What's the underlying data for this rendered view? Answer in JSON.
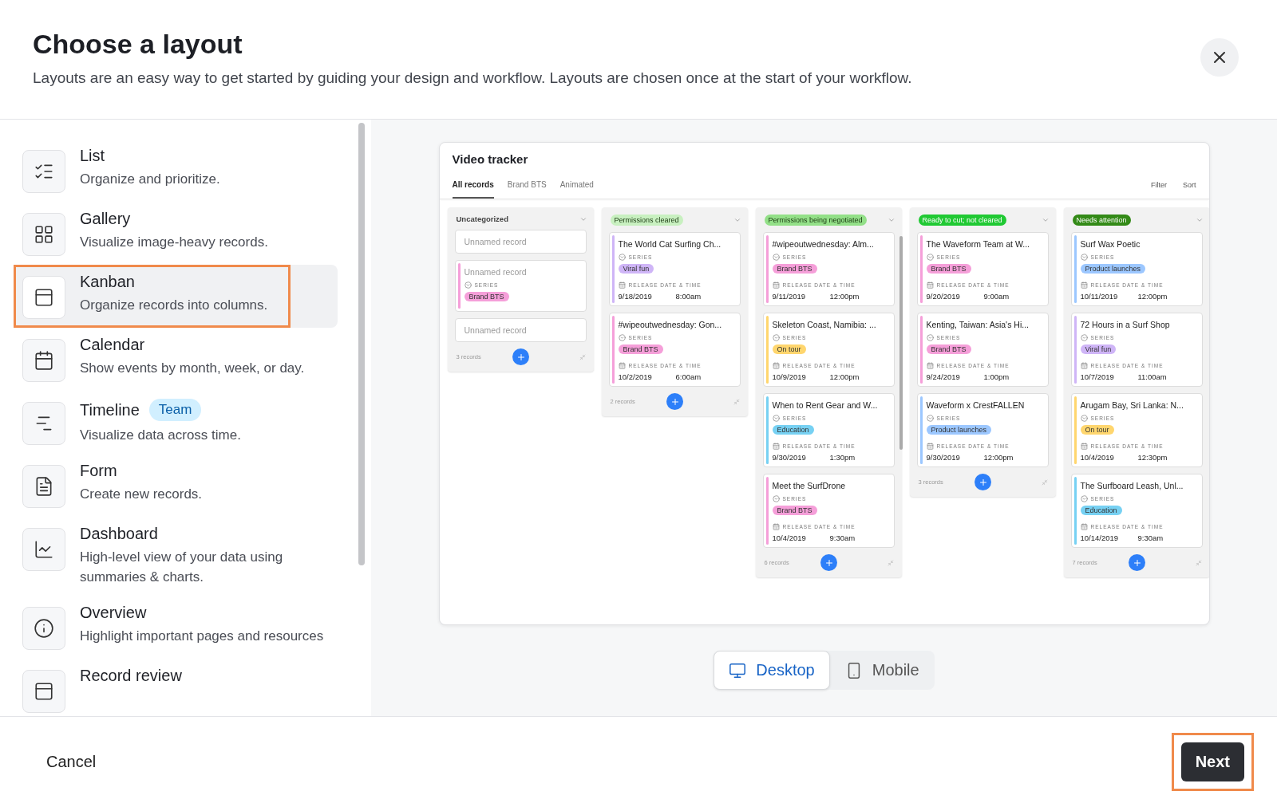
{
  "header": {
    "title": "Choose a layout",
    "description": "Layouts are an easy way to get started by guiding your design and workflow. Layouts are chosen once at the start of your workflow."
  },
  "layouts": [
    {
      "title": "List",
      "description": "Organize and prioritize.",
      "selected": false
    },
    {
      "title": "Gallery",
      "description": "Visualize image-heavy records.",
      "selected": false
    },
    {
      "title": "Kanban",
      "description": "Organize records into columns.",
      "selected": true
    },
    {
      "title": "Calendar",
      "description": "Show events by month, week, or day.",
      "selected": false
    },
    {
      "title": "Timeline",
      "badge": "Team",
      "description": "Visualize data across time.",
      "selected": false
    },
    {
      "title": "Form",
      "description": "Create new records.",
      "selected": false
    },
    {
      "title": "Dashboard",
      "description": "High-level view of your data using summaries & charts.",
      "selected": false
    },
    {
      "title": "Overview",
      "description": "Highlight important pages and resources",
      "selected": false
    },
    {
      "title": "Record review",
      "selected": false
    }
  ],
  "preview": {
    "title": "Video tracker",
    "tabs": [
      {
        "label": "All records",
        "selected": true
      },
      {
        "label": "Brand BTS",
        "selected": false
      },
      {
        "label": "Animated",
        "selected": false
      }
    ],
    "actions": [
      "Filter",
      "Sort"
    ],
    "columns": [
      {
        "name": "Uncategorized",
        "count": "3 records",
        "cards": [
          {
            "title": "Unnamed record",
            "placeholder": true
          },
          {
            "title": "Unnamed record",
            "placeholder": true,
            "series_label": "SERIES",
            "series": "Brand BTS",
            "color": "#f59fd9"
          },
          {
            "title": "Unnamed record",
            "placeholder": true
          }
        ]
      },
      {
        "name": "Permissions cleared",
        "color": "#c8f0c0",
        "count": "2 records",
        "cards": [
          {
            "title": "The World Cat Surfing Ch...",
            "placeholder": false,
            "series_label": "SERIES",
            "series": "Viral fun",
            "color": "#cfb5f7",
            "date_label": "RELEASE DATE & TIME",
            "date": "9/18/2019",
            "time": "8:00am"
          },
          {
            "title": "#wipeoutwednesday: Gon...",
            "placeholder": false,
            "series_label": "SERIES",
            "series": "Brand BTS",
            "color": "#f59fd9",
            "date_label": "RELEASE DATE & TIME",
            "date": "10/2/2019",
            "time": "6:00am"
          }
        ]
      },
      {
        "name": "Permissions being negotiated",
        "color": "#93e088",
        "count": "6 records",
        "cards": [
          {
            "title": "#wipeoutwednesday: Alm...",
            "placeholder": false,
            "series_label": "SERIES",
            "series": "Brand BTS",
            "color": "#f59fd9",
            "date_label": "RELEASE DATE & TIME",
            "date": "9/11/2019",
            "time": "12:00pm"
          },
          {
            "title": "Skeleton Coast, Namibia: ...",
            "placeholder": false,
            "series_label": "SERIES",
            "series": "On tour",
            "color": "#ffd66e",
            "date_label": "RELEASE DATE & TIME",
            "date": "10/9/2019",
            "time": "12:00pm"
          },
          {
            "title": "When to Rent Gear and W...",
            "placeholder": false,
            "series_label": "SERIES",
            "series": "Education",
            "color": "#77d1f3",
            "date_label": "RELEASE DATE & TIME",
            "date": "9/30/2019",
            "time": "1:30pm"
          },
          {
            "title": "Meet the SurfDrone",
            "placeholder": false,
            "series_label": "SERIES",
            "series": "Brand BTS",
            "color": "#f59fd9",
            "date_label": "RELEASE DATE & TIME",
            "date": "10/4/2019",
            "time": "9:30am"
          }
        ]
      },
      {
        "name": "Ready to cut; not cleared",
        "color": "#20c933",
        "count": "3 records",
        "cards": [
          {
            "title": "The Waveform Team at W...",
            "placeholder": false,
            "series_label": "SERIES",
            "series": "Brand BTS",
            "color": "#f59fd9",
            "date_label": "RELEASE DATE & TIME",
            "date": "9/20/2019",
            "time": "9:00am"
          },
          {
            "title": "Kenting, Taiwan: Asia's Hi...",
            "placeholder": false,
            "series_label": "SERIES",
            "series": "Brand BTS",
            "color": "#f59fd9",
            "date_label": "RELEASE DATE & TIME",
            "date": "9/24/2019",
            "time": "1:00pm"
          },
          {
            "title": "Waveform x CrestFALLEN",
            "placeholder": false,
            "series_label": "SERIES",
            "series": "Product launches",
            "color": "#9cc7ff",
            "date_label": "RELEASE DATE & TIME",
            "date": "9/30/2019",
            "time": "12:00pm"
          }
        ]
      },
      {
        "name": "Needs attention",
        "color": "#338a17",
        "count": "7 records",
        "cards": [
          {
            "title": "Surf Wax Poetic",
            "placeholder": false,
            "series_label": "SERIES",
            "series": "Product launches",
            "color": "#9cc7ff",
            "date_label": "RELEASE DATE & TIME",
            "date": "10/11/2019",
            "time": "12:00pm"
          },
          {
            "title": "72 Hours in a Surf Shop",
            "placeholder": false,
            "series_label": "SERIES",
            "series": "Viral fun",
            "color": "#cfb5f7",
            "date_label": "RELEASE DATE & TIME",
            "date": "10/7/2019",
            "time": "11:00am"
          },
          {
            "title": "Arugam Bay, Sri Lanka: N...",
            "placeholder": false,
            "series_label": "SERIES",
            "series": "On tour",
            "color": "#ffd66e",
            "date_label": "RELEASE DATE & TIME",
            "date": "10/4/2019",
            "time": "12:30pm"
          },
          {
            "title": "The Surfboard Leash, Unl...",
            "placeholder": false,
            "series_label": "SERIES",
            "series": "Education",
            "color": "#77d1f3",
            "date_label": "RELEASE DATE & TIME",
            "date": "10/14/2019",
            "time": "9:30am"
          }
        ]
      }
    ]
  },
  "devices": [
    {
      "label": "Desktop",
      "selected": true
    },
    {
      "label": "Mobile",
      "selected": false
    }
  ],
  "footer": {
    "cancel": "Cancel",
    "next": "Next",
    "next_highlighted": true
  }
}
